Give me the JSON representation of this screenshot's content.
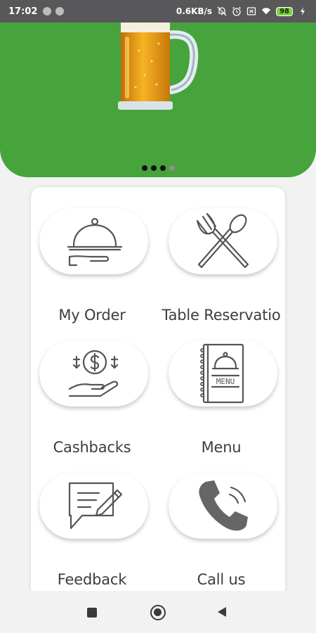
{
  "status_bar": {
    "time": "17:02",
    "network_speed": "0.6KB/s",
    "battery_level": "98",
    "icons": [
      "notification-dot-icon",
      "notification-dot-icon",
      "bell-off-icon",
      "alarm-icon",
      "sim-icon",
      "wifi-icon",
      "battery-icon",
      "charging-icon"
    ]
  },
  "banner": {
    "background_color": "#47a43c",
    "image": "beer-mug-icon",
    "carousel_page": 3,
    "carousel_total": 4
  },
  "menu": {
    "items": [
      {
        "label": "My Order",
        "icon": "serving-cloche-icon"
      },
      {
        "label": "Table Reservatio",
        "icon": "fork-spoon-icon"
      },
      {
        "label": "Cashbacks",
        "icon": "cashback-icon"
      },
      {
        "label": "Menu",
        "icon": "menu-book-icon"
      },
      {
        "label": "Feedback",
        "icon": "feedback-icon"
      },
      {
        "label": "Call us",
        "icon": "phone-icon"
      }
    ]
  },
  "nav_bar": {
    "icons": [
      "recent-apps-icon",
      "home-icon",
      "back-icon"
    ]
  }
}
